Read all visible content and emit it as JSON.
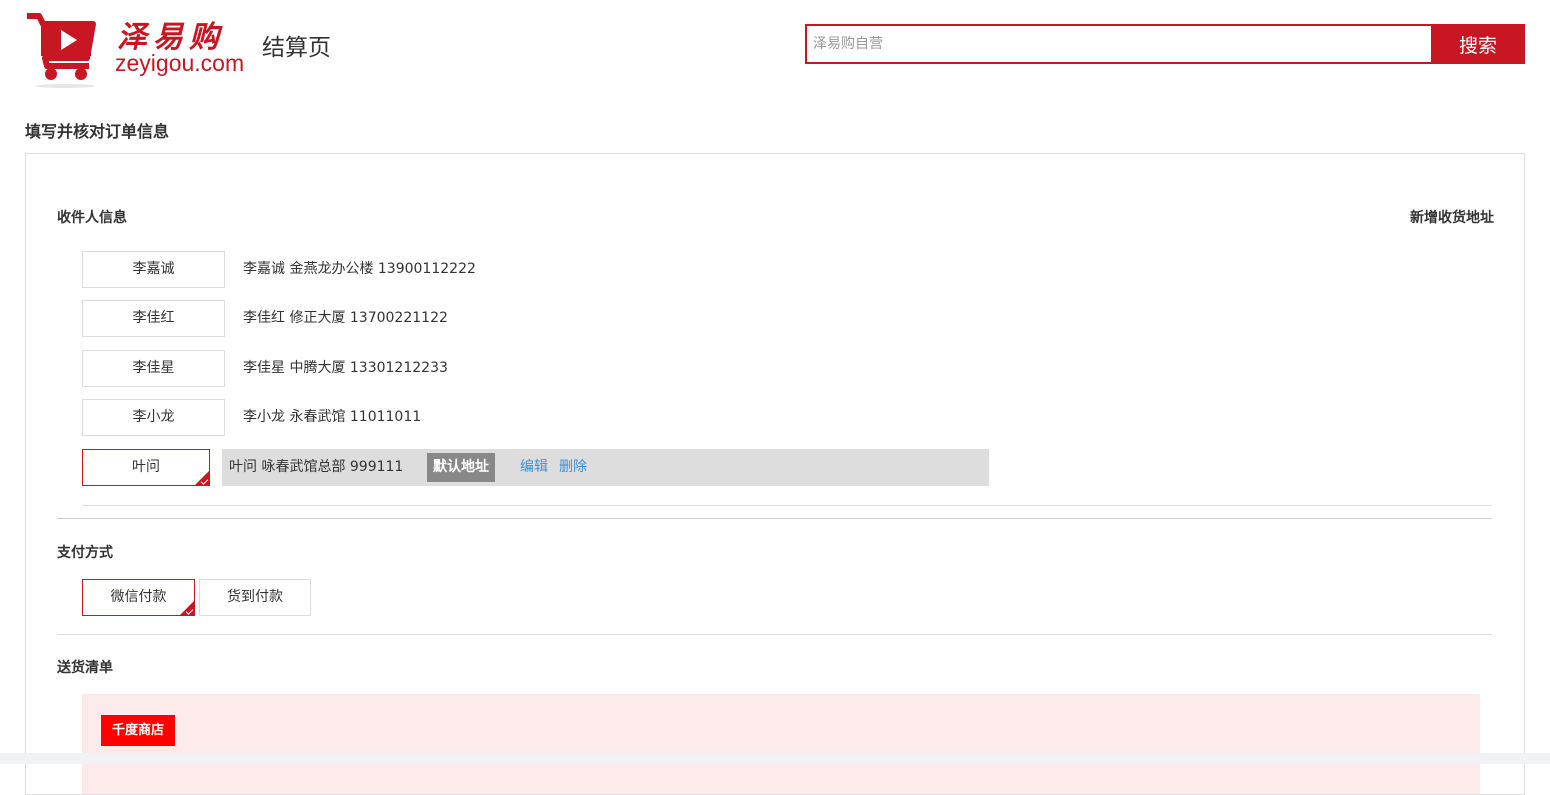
{
  "header": {
    "logo_cn": "泽易购",
    "logo_en": "zeyigou.com",
    "page_name": "结算页"
  },
  "search": {
    "placeholder": "泽易购自营",
    "button_label": "搜索"
  },
  "section_title": "填写并核对订单信息",
  "receiver": {
    "title": "收件人信息",
    "add_label": "新增收货地址",
    "addresses": [
      {
        "name": "李嘉诚",
        "detail": "李嘉诚 金燕龙办公楼 13900112222"
      },
      {
        "name": "李佳红",
        "detail": "李佳红 修正大厦 13700221122"
      },
      {
        "name": "李佳星",
        "detail": "李佳星 中腾大厦 13301212233"
      },
      {
        "name": "李小龙",
        "detail": "李小龙 永春武馆 11011011"
      },
      {
        "name": "叶问",
        "detail": "叶问 咏春武馆总部 999111",
        "badge": "默认地址",
        "edit": "编辑",
        "delete": "删除"
      }
    ]
  },
  "payment": {
    "title": "支付方式",
    "options": [
      "微信付款",
      "货到付款"
    ],
    "selected": "微信付款"
  },
  "delivery": {
    "title": "送货清单",
    "shop_name": "千度商店"
  },
  "colors": {
    "accent": "#c81623",
    "link": "#3b8fd9",
    "selected_row_bg": "#dddddd",
    "badge_bg": "#888888",
    "delivery_bg": "#fdeaea",
    "shop_tag": "#ff0000"
  }
}
